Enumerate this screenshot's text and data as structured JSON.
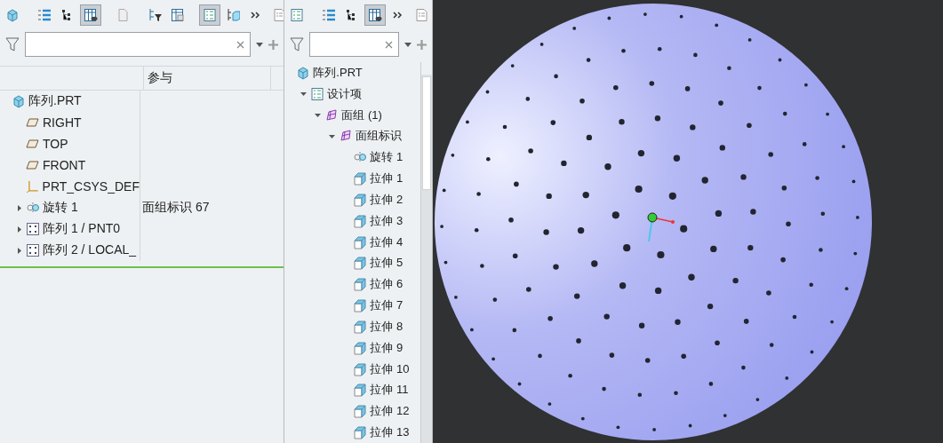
{
  "left_panel": {
    "toolbar": [
      {
        "kind": "part",
        "pressed": false
      },
      {
        "kind": "sep"
      },
      {
        "kind": "list",
        "pressed": false
      },
      {
        "kind": "tree",
        "pressed": false
      },
      {
        "kind": "columns",
        "pressed": true
      },
      {
        "kind": "sep"
      },
      {
        "kind": "doc",
        "pressed": false
      },
      {
        "kind": "sep"
      },
      {
        "kind": "filter-tree",
        "pressed": false
      },
      {
        "kind": "table",
        "pressed": false
      },
      {
        "kind": "sep"
      },
      {
        "kind": "layers",
        "pressed": true
      },
      {
        "kind": "tree-part",
        "pressed": false
      },
      {
        "kind": "more",
        "pressed": false
      },
      {
        "kind": "sheet",
        "pressed": false
      }
    ],
    "columns": [
      {},
      {
        "label": "参与"
      }
    ],
    "tree": [
      {
        "label": "阵列.PRT",
        "kind": "part",
        "children": [
          {
            "label": "RIGHT",
            "kind": "plane"
          },
          {
            "label": "TOP",
            "kind": "plane"
          },
          {
            "label": "FRONT",
            "kind": "plane"
          },
          {
            "label": "PRT_CSYS_DEF",
            "kind": "csys"
          },
          {
            "label": "旋转 1",
            "kind": "revolve",
            "expanded": false,
            "column_2": "面组标识 67"
          },
          {
            "label": "阵列 1 / PNT0",
            "kind": "pattern",
            "expanded": false
          },
          {
            "label": "阵列 2 / LOCAL_",
            "kind": "pattern",
            "expanded": false
          }
        ]
      }
    ]
  },
  "middle_panel": {
    "toolbar": [
      {
        "kind": "layers",
        "pressed": false
      },
      {
        "kind": "sep"
      },
      {
        "kind": "list",
        "pressed": false
      },
      {
        "kind": "tree",
        "pressed": false
      },
      {
        "kind": "columns",
        "pressed": true
      },
      {
        "kind": "more",
        "pressed": false
      },
      {
        "kind": "sheet",
        "pressed": false
      }
    ],
    "tree": [
      {
        "label": "阵列.PRT",
        "kind": "part",
        "children": [
          {
            "label": "设计项",
            "kind": "layers",
            "expanded": true,
            "children": [
              {
                "label": "面组 (1)",
                "kind": "quilt",
                "expanded": true,
                "children": [
                  {
                    "label": "面组标识",
                    "kind": "quilt",
                    "expanded": true,
                    "children": [
                      {
                        "label": "旋转 1",
                        "kind": "revolve"
                      },
                      {
                        "label": "拉伸 1",
                        "kind": "extrude"
                      },
                      {
                        "label": "拉伸 2",
                        "kind": "extrude"
                      },
                      {
                        "label": "拉伸 3",
                        "kind": "extrude"
                      },
                      {
                        "label": "拉伸 4",
                        "kind": "extrude"
                      },
                      {
                        "label": "拉伸 5",
                        "kind": "extrude"
                      },
                      {
                        "label": "拉伸 6",
                        "kind": "extrude"
                      },
                      {
                        "label": "拉伸 7",
                        "kind": "extrude"
                      },
                      {
                        "label": "拉伸 8",
                        "kind": "extrude"
                      },
                      {
                        "label": "拉伸 9",
                        "kind": "extrude"
                      },
                      {
                        "label": "拉伸 10",
                        "kind": "extrude"
                      },
                      {
                        "label": "拉伸 11",
                        "kind": "extrude"
                      },
                      {
                        "label": "拉伸 12",
                        "kind": "extrude"
                      },
                      {
                        "label": "拉伸 13",
                        "kind": "extrude"
                      }
                    ]
                  }
                ]
              }
            ]
          }
        ]
      }
    ]
  }
}
